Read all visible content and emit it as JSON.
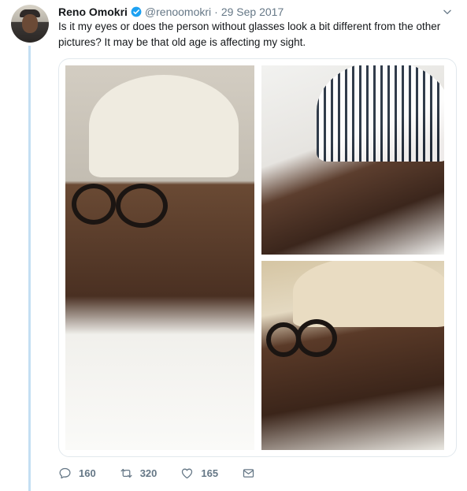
{
  "tweet": {
    "display_name": "Reno Omokri",
    "handle": "@renoomokri",
    "separator": "·",
    "date": "29 Sep 2017",
    "text": "Is it my eyes or does the person without glasses look a bit different from the other pictures? It may be that old age is affecting my sight.",
    "verified": true
  },
  "actions": {
    "reply_count": "160",
    "retweet_count": "320",
    "like_count": "165"
  },
  "icons": {
    "verified": "verified-badge-icon",
    "caret": "chevron-down-icon",
    "reply": "reply-icon",
    "retweet": "retweet-icon",
    "like": "heart-icon",
    "message": "direct-message-icon"
  },
  "colors": {
    "accent": "#1da1f2",
    "secondary_text": "#657786",
    "thread_line": "#c4dff3"
  }
}
